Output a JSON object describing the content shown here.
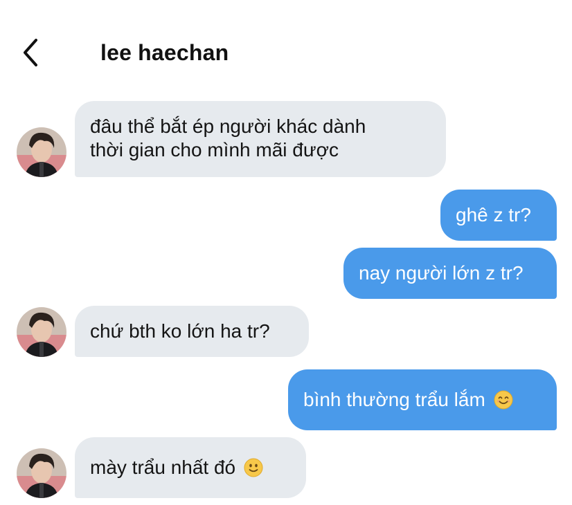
{
  "header": {
    "back_icon": "chevron-left-icon",
    "title": "lee haechan"
  },
  "messages": [
    {
      "direction": "incoming",
      "lines": [
        "đâu thể bắt ép người khác dành",
        "thời gian cho mình mãi được"
      ]
    },
    {
      "direction": "outgoing",
      "text": "ghê z tr?"
    },
    {
      "direction": "outgoing",
      "text": "nay người lớn z tr?"
    },
    {
      "direction": "incoming",
      "text": "chứ bth ko lớn ha tr?"
    },
    {
      "direction": "outgoing",
      "text": "bình thường trẩu lắm",
      "emoji": "smiling-face-icon"
    },
    {
      "direction": "incoming",
      "text": "mày trẩu nhất đó",
      "emoji": "slightly-smiling-face-icon"
    }
  ],
  "colors": {
    "incoming_bubble": "#e6eaee",
    "outgoing_bubble": "#4a9aea",
    "incoming_text": "#141414",
    "outgoing_text": "#ffffff",
    "title_text": "#111111"
  }
}
